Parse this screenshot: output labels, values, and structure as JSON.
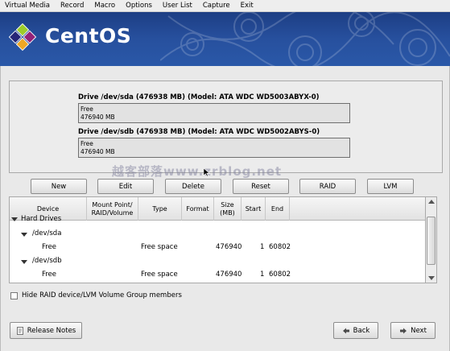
{
  "menubar": {
    "items": [
      "Virtual Media",
      "Record",
      "Macro",
      "Options",
      "User List",
      "Capture",
      "Exit"
    ]
  },
  "banner": {
    "logo_icon": "centos-logo-icon",
    "title": "CentOS",
    "color": "#27509e"
  },
  "drives": [
    {
      "title": "Drive /dev/sda (476938 MB) (Model: ATA WDC WD5003ABYX-0)",
      "line1": "Free",
      "line2": "476940 MB"
    },
    {
      "title": "Drive /dev/sdb (476938 MB) (Model: ATA WDC WD5002ABYS-0)",
      "line1": "Free",
      "line2": "476940 MB"
    }
  ],
  "buttons": {
    "new": "New",
    "edit": "Edit",
    "delete": "Delete",
    "reset": "Reset",
    "raid": "RAID",
    "lvm": "LVM"
  },
  "table": {
    "headers": [
      "Device",
      "Mount Point/\nRAID/Volume",
      "Type",
      "Format",
      "Size\n(MB)",
      "Start",
      "End"
    ],
    "group": "Hard Drives",
    "rows": [
      {
        "device": "/dev/sda",
        "kind": "disk"
      },
      {
        "device": "Free",
        "type": "Free space",
        "size": "476940",
        "start": "1",
        "end": "60802",
        "kind": "part"
      },
      {
        "device": "/dev/sdb",
        "kind": "disk"
      },
      {
        "device": "Free",
        "type": "Free space",
        "size": "476940",
        "start": "1",
        "end": "60802",
        "kind": "part"
      }
    ]
  },
  "hide_raid_label": "Hide RAID device/LVM Volume Group members",
  "footer": {
    "release_notes": "Release Notes",
    "back": "Back",
    "next": "Next"
  },
  "watermark": "越客部落www.zrblog.net"
}
